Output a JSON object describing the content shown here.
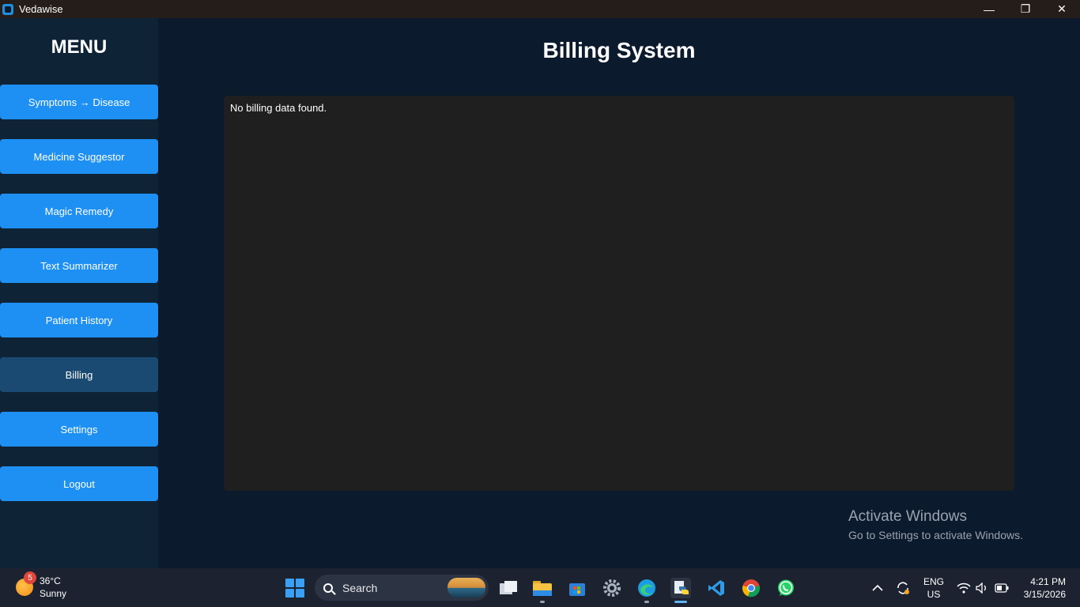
{
  "window": {
    "title": "Vedawise",
    "controls": {
      "minimize": "—",
      "restore": "❐",
      "close": "✕"
    }
  },
  "sidebar": {
    "title": "MENU",
    "items": [
      {
        "label": "Symptoms → Disease"
      },
      {
        "label": "Medicine Suggestor"
      },
      {
        "label": "Magic Remedy"
      },
      {
        "label": "Text Summarizer"
      },
      {
        "label": "Patient History"
      },
      {
        "label": "Billing",
        "active": true
      },
      {
        "label": "Settings"
      },
      {
        "label": "Logout"
      }
    ]
  },
  "main": {
    "title": "Billing System",
    "message": "No billing data found."
  },
  "watermark": {
    "title": "Activate Windows",
    "subtitle": "Go to Settings to activate Windows."
  },
  "taskbar": {
    "weather": {
      "badge": "5",
      "temp": "36°C",
      "condition": "Sunny"
    },
    "search_placeholder": "Search",
    "language": {
      "line1": "ENG",
      "line2": "US"
    },
    "clock": {
      "time": "4:21 PM",
      "date": "3/15/2026"
    },
    "apps": [
      "file-manager-icon",
      "file-explorer-icon",
      "microsoft-store-icon",
      "settings-icon",
      "edge-browser-icon",
      "python-icon",
      "vscode-icon",
      "chrome-icon",
      "whatsapp-icon"
    ]
  },
  "colors": {
    "button": "#1e90f4",
    "button_active": "#1a4a72",
    "sidebar_bg": "#0f2337",
    "main_bg": "#0b1a2d",
    "panel_bg": "#1f1f1f"
  }
}
